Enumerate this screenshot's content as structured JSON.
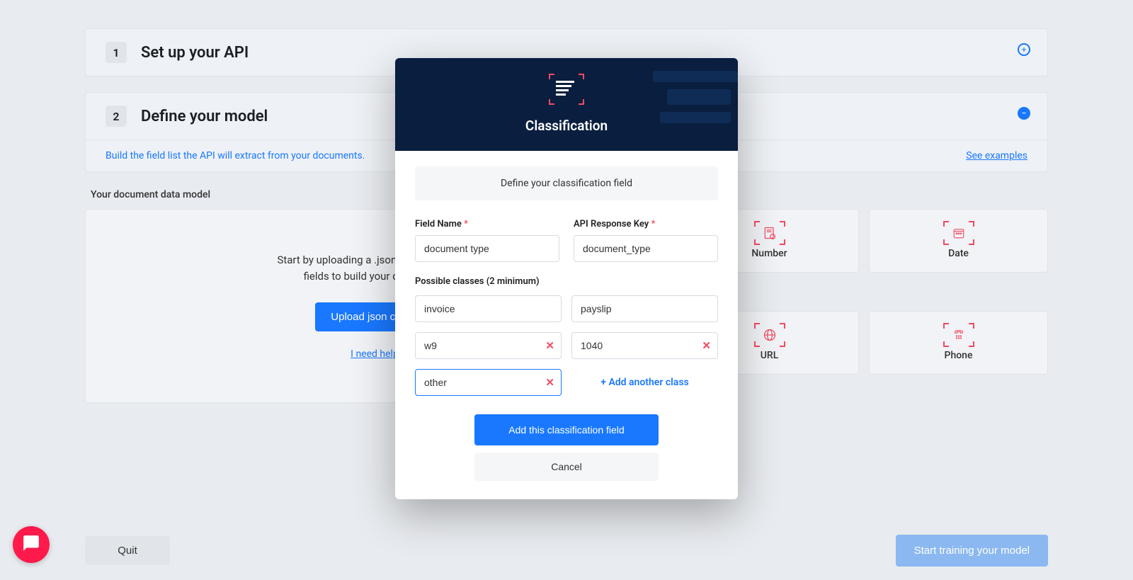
{
  "steps": {
    "one": {
      "num": "1",
      "title": "Set up your API"
    },
    "two": {
      "num": "2",
      "title": "Define your model",
      "info": "Build the field list the API will extract from your documents.",
      "examples_link": "See examples"
    }
  },
  "model_section": {
    "label": "Your document data model",
    "upload": {
      "desc": "Start by uploading a .json config or select fields to build your data model",
      "button": "Upload json config",
      "help_link": "I need help"
    },
    "tiles": {
      "number": "Number",
      "date": "Date",
      "url": "URL",
      "phone": "Phone"
    }
  },
  "footer": {
    "quit": "Quit",
    "train": "Start training your model"
  },
  "modal": {
    "title": "Classification",
    "banner": "Define your classification field",
    "field_name_label": "Field Name",
    "field_name_value": "document type",
    "api_key_label": "API Response Key",
    "api_key_value": "document_type",
    "classes_label": "Possible classes (2 minimum)",
    "classes": [
      "invoice",
      "payslip",
      "w9",
      "1040",
      "other"
    ],
    "add_another": "+ Add another class",
    "add_button": "Add this classification field",
    "cancel_button": "Cancel",
    "required_marker": "*"
  }
}
